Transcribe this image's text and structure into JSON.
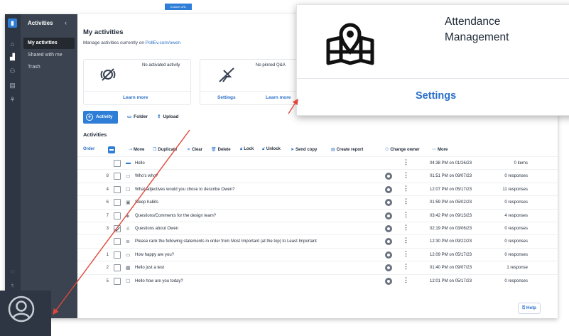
{
  "custom_url_badge": "Custom URL",
  "sidebar": {
    "title": "Activities",
    "collapse_icon": "chevron-left-icon",
    "items": [
      {
        "label": "My activities",
        "active": true
      },
      {
        "label": "Shared with me",
        "active": false
      },
      {
        "label": "Trash",
        "active": false
      }
    ]
  },
  "main": {
    "title": "My activities",
    "subtitle_prefix": "Manage activities currently on ",
    "subtitle_link": "PollEv.com/owen",
    "cards": {
      "activated": {
        "caption": "No activated activity",
        "link": "Learn more"
      },
      "pinned": {
        "caption": "No pinned Q&A",
        "settings": "Settings",
        "link": "Learn more"
      }
    },
    "actions": {
      "activity": "Activity",
      "folder": "Folder",
      "upload": "Upload"
    },
    "section_title": "Activities",
    "toolbar": {
      "order": "Order",
      "move": "Move",
      "duplicate": "Duplicate",
      "clear": "Clear",
      "delete": "Delete",
      "lock": "Lock",
      "unlock": "Unlock",
      "send_copy": "Send copy",
      "create_report": "Create report",
      "change_owner": "Change owner",
      "more": "More"
    },
    "rows": [
      {
        "order": "",
        "icon": "folder-icon",
        "title": "Hello",
        "date": "04:38 PM on 01/26/23",
        "responses": "0 items",
        "checked": false,
        "broadcast": false
      },
      {
        "order": "8",
        "icon": "multiple-choice-icon",
        "title": "Who's who?",
        "date": "01:51 PM on 09/07/23",
        "responses": "0 responses",
        "checked": false,
        "broadcast": true
      },
      {
        "order": "4",
        "icon": "open-ended-icon",
        "title": "What adjectives would you chose to describe Owen?",
        "date": "12:07 PM on 05/17/23",
        "responses": "11 responses",
        "checked": false,
        "broadcast": true
      },
      {
        "order": "6",
        "icon": "poll-icon",
        "title": "Sleep habits",
        "date": "01:59 PM on 05/02/23",
        "responses": "0 responses",
        "checked": false,
        "broadcast": true
      },
      {
        "order": "7",
        "icon": "qa-icon",
        "title": "Questions/Comments for the design team?",
        "date": "03:42 PM on 09/13/23",
        "responses": "4 responses",
        "checked": false,
        "broadcast": true
      },
      {
        "order": "3",
        "icon": "trophy-icon",
        "title": "Questions about Owen",
        "date": "02:19 PM on 03/06/23",
        "responses": "0 responses",
        "checked": true,
        "broadcast": true
      },
      {
        "order": "",
        "icon": "ranking-icon",
        "title": "Please rank the following statements in order from Most Important (at the top) to Least Important",
        "date": "12:30 PM on 09/22/23",
        "responses": "0 responses",
        "checked": false,
        "broadcast": true
      },
      {
        "order": "1",
        "icon": "multiple-choice-icon",
        "title": "How happy are you?",
        "date": "12:09 PM on 05/17/23",
        "responses": "0 responses",
        "checked": false,
        "broadcast": true
      },
      {
        "order": "2",
        "icon": "grid-icon",
        "title": "Hello just a test",
        "date": "01:40 PM on 09/07/23",
        "responses": "1 response",
        "checked": false,
        "broadcast": true
      },
      {
        "order": "5",
        "icon": "open-ended-icon",
        "title": "Hello how are you today?",
        "date": "12:01 PM on 05/17/23",
        "responses": "0 responses",
        "checked": false,
        "broadcast": true
      }
    ],
    "help": "Help"
  },
  "zoom_callout": {
    "title": "Attendance Management",
    "settings": "Settings",
    "icon": "map-pin-grid-icon"
  },
  "colors": {
    "accent": "#2e7dd7",
    "sidebar": "#3a434f",
    "rail": "#2d3642",
    "arrow": "#e0483a"
  }
}
